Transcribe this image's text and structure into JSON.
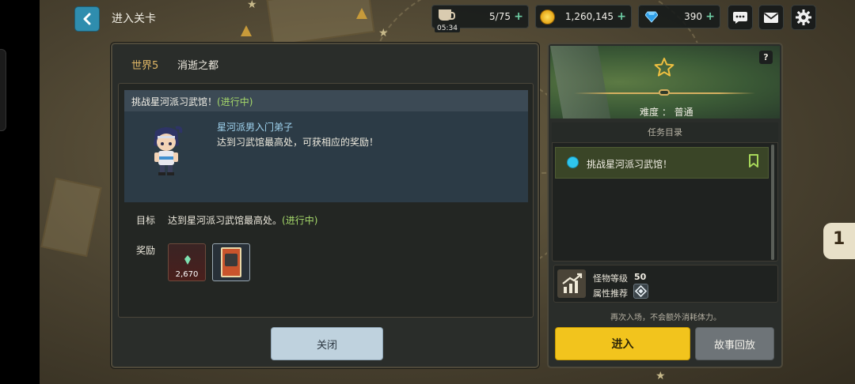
{
  "header": {
    "title": "进入关卡"
  },
  "resources": {
    "stamina": {
      "value": "5/75",
      "timer": "05:34"
    },
    "gold": {
      "value": "1,260,145"
    },
    "gems": {
      "value": "390"
    },
    "plus_symbol": "+"
  },
  "map": {
    "stage_number": "5",
    "side_number": "1"
  },
  "stage": {
    "world_label": "世界5",
    "world_name": "消逝之都",
    "quest_title": "挑战星河派习武馆！",
    "quest_status": "(进行中)",
    "npc_name": "星河派男入门弟子",
    "npc_dialogue": "达到习武馆最高处，可获相应的奖励！",
    "goal_label": "目标",
    "goal_text": "达到星河派习武馆最高处。",
    "goal_status": "(进行中)",
    "reward_label": "奖励",
    "rewards": [
      {
        "icon": "crystal-icon",
        "quantity": "2,670"
      },
      {
        "icon": "card-icon",
        "quantity": ""
      }
    ],
    "close_label": "关闭"
  },
  "info": {
    "help_label": "?",
    "difficulty": "难度 ： 普通",
    "mission_header": "任务目录",
    "missions": [
      {
        "text": "挑战星河派习武馆！",
        "dot_color": "#2fc6ee"
      }
    ],
    "monster_level_label": "怪物等级",
    "monster_level_value": "50",
    "attribute_label": "属性推荐",
    "reentry_note": "再次入场，不会额外消耗体力。",
    "enter_label": "进入",
    "replay_label": "故事回放"
  },
  "colors": {
    "accent_yellow": "#f2c41d",
    "back_button": "#2f8dae",
    "progress_green": "#a5d86a",
    "npc_name_blue": "#9fd3ef"
  }
}
